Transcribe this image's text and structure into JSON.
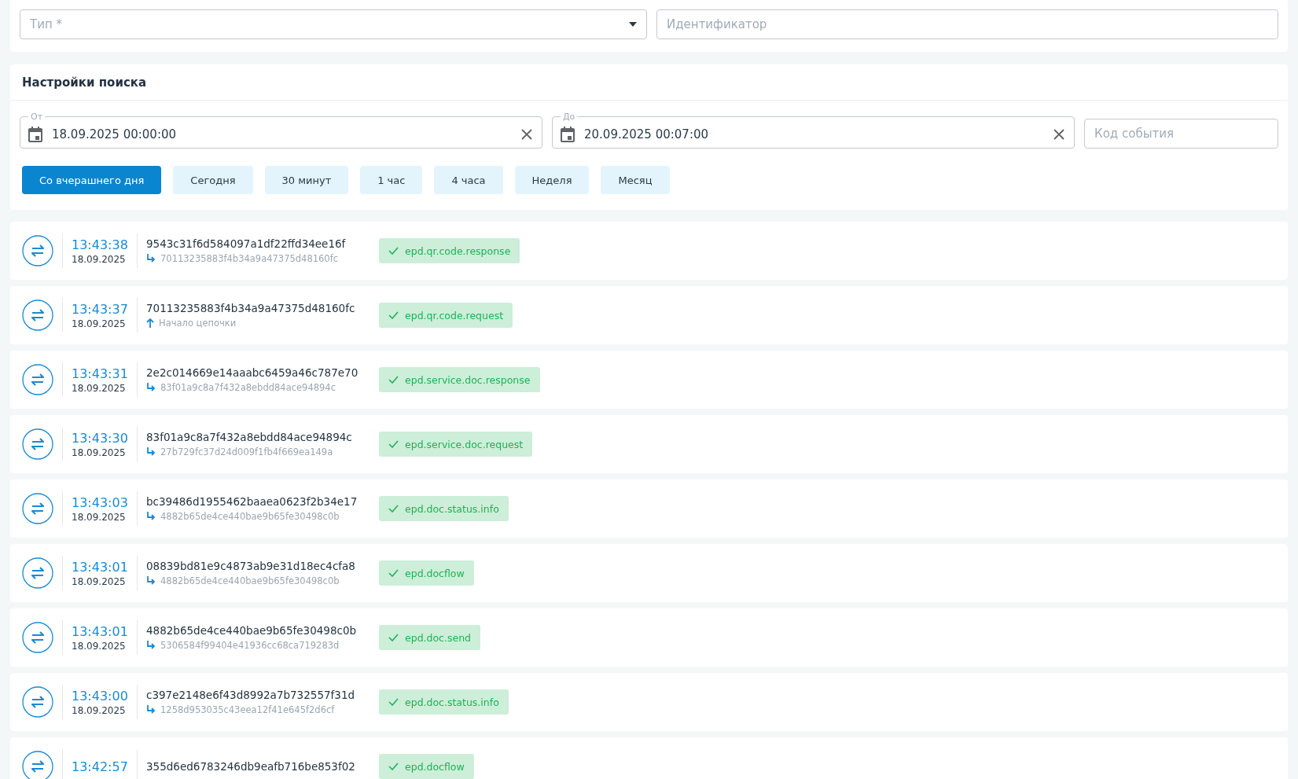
{
  "filters": {
    "type": {
      "placeholder": "Тип *"
    },
    "identifier": {
      "placeholder": "Идентификатор"
    }
  },
  "search_settings": {
    "title": "Настройки поиска",
    "from": {
      "label": "От",
      "value": "18.09.2025 00:00:00"
    },
    "to": {
      "label": "До",
      "value": "20.09.2025 00:07:00"
    },
    "event_code": {
      "placeholder": "Код события"
    },
    "presets": [
      {
        "label": "Со вчерашнего дня",
        "selected": true
      },
      {
        "label": "Сегодня",
        "selected": false
      },
      {
        "label": "30 минут",
        "selected": false
      },
      {
        "label": "1 час",
        "selected": false
      },
      {
        "label": "4 часа",
        "selected": false
      },
      {
        "label": "Неделя",
        "selected": false
      },
      {
        "label": "Месяц",
        "selected": false
      }
    ]
  },
  "events": [
    {
      "time": "13:43:38",
      "date": "18.09.2025",
      "id": "9543c31f6d584097a1df22ffd34ee16f",
      "parent": {
        "kind": "link",
        "text": "70113235883f4b34a9a47375d48160fc"
      },
      "tag": "epd.qr.code.response"
    },
    {
      "time": "13:43:37",
      "date": "18.09.2025",
      "id": "70113235883f4b34a9a47375d48160fc",
      "parent": {
        "kind": "start",
        "text": "Начало цепочки"
      },
      "tag": "epd.qr.code.request"
    },
    {
      "time": "13:43:31",
      "date": "18.09.2025",
      "id": "2e2c014669e14aaabc6459a46c787e70",
      "parent": {
        "kind": "link",
        "text": "83f01a9c8a7f432a8ebdd84ace94894c"
      },
      "tag": "epd.service.doc.response"
    },
    {
      "time": "13:43:30",
      "date": "18.09.2025",
      "id": "83f01a9c8a7f432a8ebdd84ace94894c",
      "parent": {
        "kind": "link",
        "text": "27b729fc37d24d009f1fb4f669ea149a"
      },
      "tag": "epd.service.doc.request"
    },
    {
      "time": "13:43:03",
      "date": "18.09.2025",
      "id": "bc39486d1955462baaea0623f2b34e17",
      "parent": {
        "kind": "link",
        "text": "4882b65de4ce440bae9b65fe30498c0b"
      },
      "tag": "epd.doc.status.info"
    },
    {
      "time": "13:43:01",
      "date": "18.09.2025",
      "id": "08839bd81e9c4873ab9e31d18ec4cfa8",
      "parent": {
        "kind": "link",
        "text": "4882b65de4ce440bae9b65fe30498c0b"
      },
      "tag": "epd.docflow"
    },
    {
      "time": "13:43:01",
      "date": "18.09.2025",
      "id": "4882b65de4ce440bae9b65fe30498c0b",
      "parent": {
        "kind": "link",
        "text": "5306584f99404e41936cc68ca719283d"
      },
      "tag": "epd.doc.send"
    },
    {
      "time": "13:43:00",
      "date": "18.09.2025",
      "id": "c397e2148e6f43d8992a7b732557f31d",
      "parent": {
        "kind": "link",
        "text": "1258d953035c43eea12f41e645f2d6cf"
      },
      "tag": "epd.doc.status.info"
    },
    {
      "time": "13:42:57",
      "id": "355d6ed6783246db9eafb716be853f02",
      "tag": "epd.docflow"
    }
  ]
}
